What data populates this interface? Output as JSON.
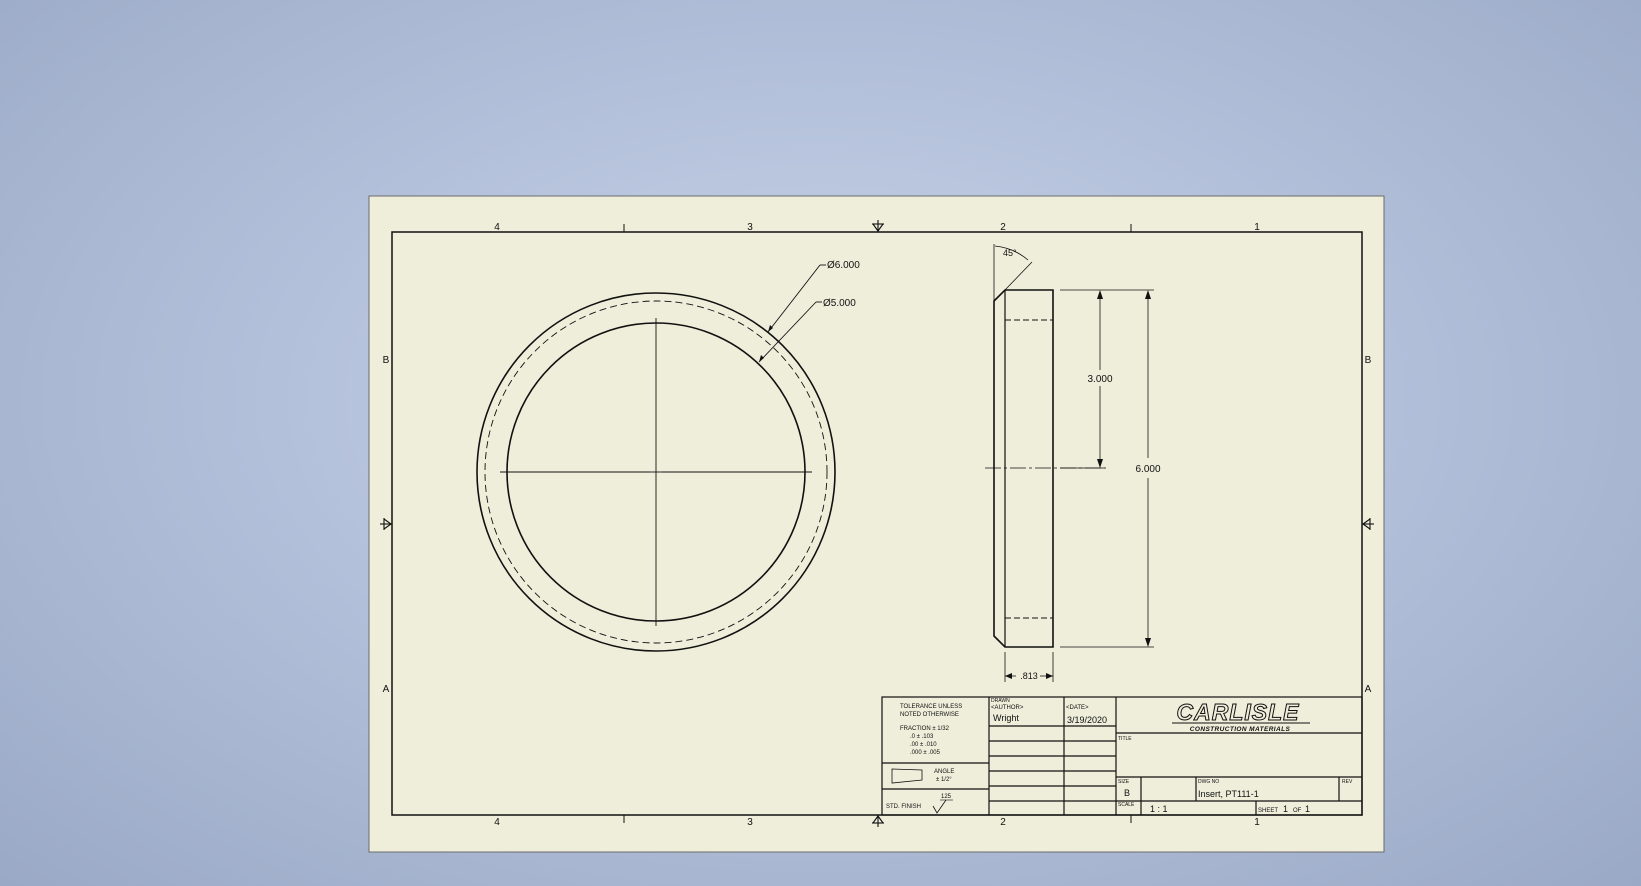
{
  "zones": {
    "columns": [
      "4",
      "3",
      "2",
      "1"
    ],
    "rows": [
      "B",
      "A"
    ]
  },
  "dimensions": {
    "outer_diameter": "Ø6.000",
    "inner_diameter": "Ø5.000",
    "chamfer_angle": "45°",
    "half_height": "3.000",
    "height": "6.000",
    "thickness": ".813"
  },
  "title_block": {
    "tolerance_header": [
      "TOLERANCE UNLESS",
      "NOTED OTHERWISE"
    ],
    "tolerance_lines": [
      "FRACTION ± 1/32",
      ".0 ± .103",
      ".00 ± .010",
      ".000 ± .005"
    ],
    "angle_label": "ANGLE",
    "angle_tol": "± 1/2°",
    "std_finish_label": "STD. FINISH",
    "std_finish_value": "125",
    "drawn_label": "DRAWN",
    "author_placeholder": "<AUTHOR>",
    "date_placeholder": "<DATE>",
    "author": "Wright",
    "date": "3/19/2020",
    "company_logo": "CARLISLE",
    "company_sub": "CONSTRUCTION MATERIALS",
    "title_label": "TITLE",
    "size_label": "SIZE",
    "size": "B",
    "dwg_no_label": "DWG NO",
    "dwg_no": "Insert, PT111-1",
    "rev_label": "REV",
    "scale_label": "SCALE",
    "scale": "1 : 1",
    "sheet_label": "SHEET",
    "sheet": "1",
    "of_label": "OF",
    "sheet_total": "1"
  },
  "colors": {
    "paper": "#eeeedb",
    "background": "#b4c1db",
    "line": "#111111"
  }
}
